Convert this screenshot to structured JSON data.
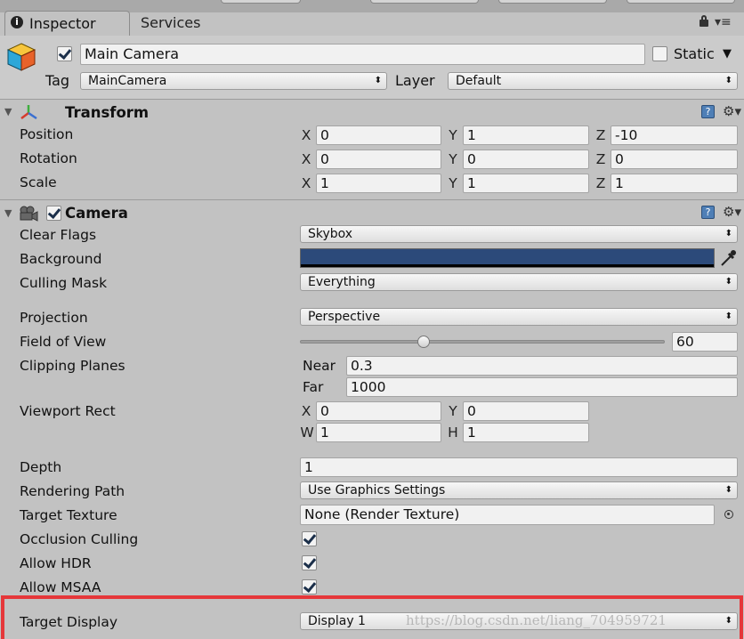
{
  "tabs": {
    "inspector": "Inspector",
    "services": "Services"
  },
  "object": {
    "name": "Main Camera",
    "static_label": "Static",
    "tag_label": "Tag",
    "tag_value": "MainCamera",
    "layer_label": "Layer",
    "layer_value": "Default"
  },
  "transform": {
    "title": "Transform",
    "rows": [
      {
        "label": "Position",
        "x": "0",
        "y": "1",
        "z": "-10"
      },
      {
        "label": "Rotation",
        "x": "0",
        "y": "0",
        "z": "0"
      },
      {
        "label": "Scale",
        "x": "1",
        "y": "1",
        "z": "1"
      }
    ]
  },
  "axes": {
    "x": "X",
    "y": "Y",
    "z": "Z",
    "w": "W",
    "h": "H"
  },
  "camera": {
    "title": "Camera",
    "clear_flags": {
      "label": "Clear Flags",
      "value": "Skybox"
    },
    "background": {
      "label": "Background",
      "color": "#2c4a7a"
    },
    "culling_mask": {
      "label": "Culling Mask",
      "value": "Everything"
    },
    "projection": {
      "label": "Projection",
      "value": "Perspective"
    },
    "fov": {
      "label": "Field of View",
      "value": "60",
      "slider_fraction": 0.3333
    },
    "clipping": {
      "label": "Clipping Planes",
      "near_label": "Near",
      "near": "0.3",
      "far_label": "Far",
      "far": "1000"
    },
    "viewport": {
      "label": "Viewport Rect",
      "x": "0",
      "y": "0",
      "w": "1",
      "h": "1"
    },
    "depth": {
      "label": "Depth",
      "value": "1"
    },
    "rendering_path": {
      "label": "Rendering Path",
      "value": "Use Graphics Settings"
    },
    "target_texture": {
      "label": "Target Texture",
      "value": "None (Render Texture)"
    },
    "occlusion_culling": {
      "label": "Occlusion Culling"
    },
    "allow_hdr": {
      "label": "Allow HDR"
    },
    "allow_msaa": {
      "label": "Allow MSAA"
    },
    "target_display": {
      "label": "Target Display",
      "value": "Display 1"
    }
  },
  "watermark": "https://blog.csdn.net/liang_704959721",
  "colors": {
    "highlight": "#e5373a",
    "panel": "#c2c2c2"
  }
}
